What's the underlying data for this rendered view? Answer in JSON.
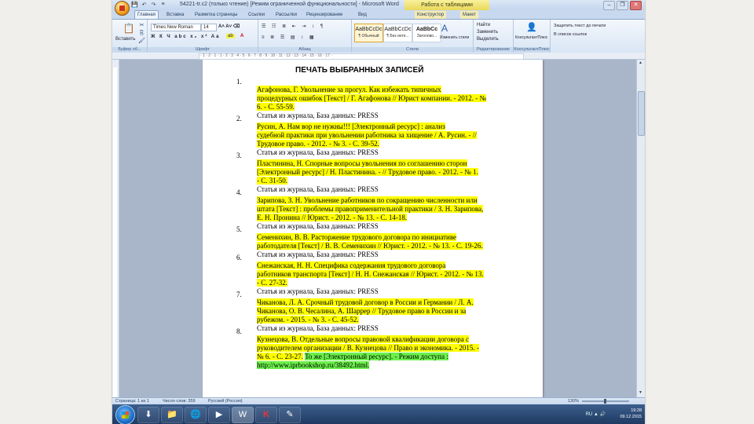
{
  "window": {
    "title": "54221-tr.c2 (только чтение) [Режим ограниченной функциональности] - Microsoft Word",
    "context_title": "Работа с таблицами",
    "controls": [
      "–",
      "❐",
      "✕"
    ]
  },
  "qat": [
    "💾",
    "↶",
    "↷",
    "≡"
  ],
  "tabs": [
    {
      "label": "Главная"
    },
    {
      "label": "Вставка"
    },
    {
      "label": "Разметка страницы"
    },
    {
      "label": "Ссылки"
    },
    {
      "label": "Рассылки"
    },
    {
      "label": "Рецензирование"
    },
    {
      "label": "Вид"
    },
    {
      "label": "Конструктор"
    },
    {
      "label": "Макет"
    }
  ],
  "ribbon": {
    "clipboard": {
      "paste": "Вставить",
      "label": "Буфер об..."
    },
    "font": {
      "name": "Times New Roman",
      "size": "14",
      "label": "Шрифт"
    },
    "paragraph": {
      "label": "Абзац"
    },
    "styles": {
      "tiles": [
        {
          "sample": "AaBbCcDc",
          "name": "¶ Обычный"
        },
        {
          "sample": "AaBbCcDc",
          "name": "¶ Без инте..."
        },
        {
          "sample": "AaBbCc",
          "name": "Заголово..."
        }
      ],
      "change": "Изменить стили",
      "label": "Стили"
    },
    "editing": {
      "find": "Найти",
      "replace": "Заменить",
      "select": "Выделить",
      "label": "Редактирование"
    },
    "konsult": {
      "button": "КонсультантПлюс",
      "label": "КонсультантПлюс"
    },
    "protect": {
      "a": "Защитить текст до печати",
      "b": "В список ссылок"
    }
  },
  "ruler_text": "· 1 · 2 · 1 · 1 · 2 · 3 · 4 · 5 · 6 · 7 · 8 · 9 · 10 · 11 · 12 · 13 · 14 · 15 · 16 · 17 ·",
  "document": {
    "title": "ПЕЧАТЬ ВЫБРАННЫХ ЗАПИСЕЙ",
    "entries": [
      {
        "num": "1.",
        "lines": [
          {
            "hl": "Агафонова, Г. Увольнение за прогул. Как избежать типичных"
          },
          {
            "hl": "процедурных ошибок [Текст] / Г. Агафонова // Юрист компании. - 2012. - №"
          },
          {
            "hl": "6. - С. 55-59."
          }
        ],
        "source": "Статья из журнала, База данных: PRESS"
      },
      {
        "num": "2.",
        "lines": [
          {
            "hl": "Русин, А. Нам вор не нужны!!! [Электронный ресурс] : анализ"
          },
          {
            "hl": "судебной практики при увольнении работника за хищение / А. Русин. - //"
          },
          {
            "hl": "Трудовое право. - 2012. - № 3. - С. 39-52."
          }
        ],
        "source": "Статья из журнала, База данных: PRESS"
      },
      {
        "num": "3.",
        "lines": [
          {
            "hl": "Пластинина, Н. Спорные вопросы увольнения по соглашению сторон"
          },
          {
            "hl": "[Электронный ресурс] / Н. Пластинина. - // Трудовое право. - 2012. - № 1."
          },
          {
            "hl": "- С. 31-50."
          }
        ],
        "source": "Статья из журнала, База данных: PRESS"
      },
      {
        "num": "4.",
        "lines": [
          {
            "hl": "Зарипова, З. Н. Увольнение работников по сокращению численности или"
          },
          {
            "hl": "штата [Текст] : проблемы правоприменительной практики / З. Н. Зарипова,"
          },
          {
            "hl": "Е. Н. Пронина // Юрист. - 2012. - № 13. - С. 14-18."
          }
        ],
        "source": "Статья из журнала, База данных: PRESS"
      },
      {
        "num": "5.",
        "lines": [
          {
            "hl": "Семенихин, В. В. Расторжение трудового договора по инициативе"
          },
          {
            "hl": "работодателя [Текст] / В. В. Семенихин // Юрист. - 2012. - № 13. - С. 19-26."
          }
        ],
        "source": "Статья из журнала, База данных: PRESS"
      },
      {
        "num": "6.",
        "lines": [
          {
            "hl": "Снежанская, Н. Н. Специфика содержания трудового договора"
          },
          {
            "hl": "работников транспорта [Текст] / Н. Н. Снежанская // Юрист. - 2012. - № 13."
          },
          {
            "hl": "- С. 27-32."
          }
        ],
        "source": "Статья из журнала, База данных: PRESS"
      },
      {
        "num": "7.",
        "lines": [
          {
            "hl": "Чиканова, Л. А. Срочный трудовой договор в России и Германии / Л. А."
          },
          {
            "hl": "Чиканова, О. В. Чеcалина, А. Шаррер // Трудовое право в России и за"
          },
          {
            "hl": "рубежом. - 2015. - № 3. - С. 45-52."
          }
        ],
        "source": "Статья из журнала, База данных: PRESS"
      },
      {
        "num": "8.",
        "lines": [
          {
            "hl": "Кузнецова, В. Отдельные вопросы правовой квалификации договора с"
          },
          {
            "hl": "руководителем организации / В. Кузнецова // Право и экономика. - 2015. -"
          },
          {
            "hl": "№ 6. - С. 23-27.",
            "green": "То же [Электронный ресурс]. - Режим доступа :"
          },
          {
            "green": "http://www.iprbookshop.ru/38492.html."
          }
        ]
      }
    ]
  },
  "status": {
    "page": "Страница: 1 из 1",
    "words": "Число слов: 359",
    "lang": "Русский (Россия)",
    "zoom": "130%"
  },
  "taskbar": {
    "buttons": [
      "⬇",
      "📁",
      "🌐",
      "▶",
      "W",
      "K",
      "✎"
    ],
    "time": "19:28",
    "date": "09.12.2015",
    "tray": "RU ▲ 🔊"
  }
}
